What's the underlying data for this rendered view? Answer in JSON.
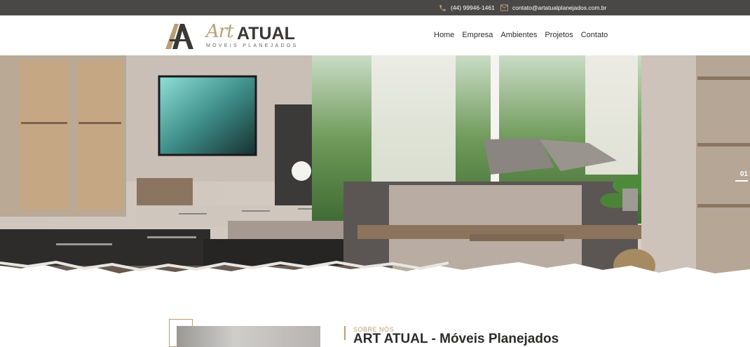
{
  "topbar": {
    "phone": "(44) 99946-1461",
    "email": "contato@artatualplanejados.com.br",
    "phone_icon": "phone-icon",
    "email_icon": "envelope-icon"
  },
  "header": {
    "logo_script": "Art",
    "logo_bold": "ATUAL",
    "logo_sub": "MÓVEIS PLANEJADOS",
    "nav": [
      "Home",
      "Empresa",
      "Ambientes",
      "Projetos",
      "Contato"
    ]
  },
  "hero": {
    "slide_number": "01"
  },
  "about": {
    "kicker": "SOBRE NÓS",
    "title": "ART ATUAL - Móveis Planejados"
  },
  "colors": {
    "topbar": "#4a4846",
    "gold": "#b99f76",
    "text": "#2d2c2b"
  }
}
